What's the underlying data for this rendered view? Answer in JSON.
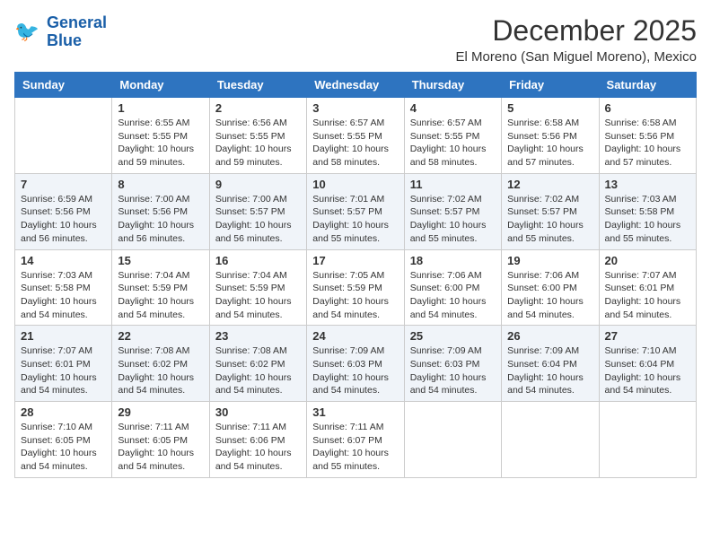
{
  "header": {
    "logo_line1": "General",
    "logo_line2": "Blue",
    "month": "December 2025",
    "location": "El Moreno (San Miguel Moreno), Mexico"
  },
  "weekdays": [
    "Sunday",
    "Monday",
    "Tuesday",
    "Wednesday",
    "Thursday",
    "Friday",
    "Saturday"
  ],
  "weeks": [
    [
      {
        "day": "",
        "sunrise": "",
        "sunset": "",
        "daylight": ""
      },
      {
        "day": "1",
        "sunrise": "Sunrise: 6:55 AM",
        "sunset": "Sunset: 5:55 PM",
        "daylight": "Daylight: 10 hours and 59 minutes."
      },
      {
        "day": "2",
        "sunrise": "Sunrise: 6:56 AM",
        "sunset": "Sunset: 5:55 PM",
        "daylight": "Daylight: 10 hours and 59 minutes."
      },
      {
        "day": "3",
        "sunrise": "Sunrise: 6:57 AM",
        "sunset": "Sunset: 5:55 PM",
        "daylight": "Daylight: 10 hours and 58 minutes."
      },
      {
        "day": "4",
        "sunrise": "Sunrise: 6:57 AM",
        "sunset": "Sunset: 5:55 PM",
        "daylight": "Daylight: 10 hours and 58 minutes."
      },
      {
        "day": "5",
        "sunrise": "Sunrise: 6:58 AM",
        "sunset": "Sunset: 5:56 PM",
        "daylight": "Daylight: 10 hours and 57 minutes."
      },
      {
        "day": "6",
        "sunrise": "Sunrise: 6:58 AM",
        "sunset": "Sunset: 5:56 PM",
        "daylight": "Daylight: 10 hours and 57 minutes."
      }
    ],
    [
      {
        "day": "7",
        "sunrise": "Sunrise: 6:59 AM",
        "sunset": "Sunset: 5:56 PM",
        "daylight": "Daylight: 10 hours and 56 minutes."
      },
      {
        "day": "8",
        "sunrise": "Sunrise: 7:00 AM",
        "sunset": "Sunset: 5:56 PM",
        "daylight": "Daylight: 10 hours and 56 minutes."
      },
      {
        "day": "9",
        "sunrise": "Sunrise: 7:00 AM",
        "sunset": "Sunset: 5:57 PM",
        "daylight": "Daylight: 10 hours and 56 minutes."
      },
      {
        "day": "10",
        "sunrise": "Sunrise: 7:01 AM",
        "sunset": "Sunset: 5:57 PM",
        "daylight": "Daylight: 10 hours and 55 minutes."
      },
      {
        "day": "11",
        "sunrise": "Sunrise: 7:02 AM",
        "sunset": "Sunset: 5:57 PM",
        "daylight": "Daylight: 10 hours and 55 minutes."
      },
      {
        "day": "12",
        "sunrise": "Sunrise: 7:02 AM",
        "sunset": "Sunset: 5:57 PM",
        "daylight": "Daylight: 10 hours and 55 minutes."
      },
      {
        "day": "13",
        "sunrise": "Sunrise: 7:03 AM",
        "sunset": "Sunset: 5:58 PM",
        "daylight": "Daylight: 10 hours and 55 minutes."
      }
    ],
    [
      {
        "day": "14",
        "sunrise": "Sunrise: 7:03 AM",
        "sunset": "Sunset: 5:58 PM",
        "daylight": "Daylight: 10 hours and 54 minutes."
      },
      {
        "day": "15",
        "sunrise": "Sunrise: 7:04 AM",
        "sunset": "Sunset: 5:59 PM",
        "daylight": "Daylight: 10 hours and 54 minutes."
      },
      {
        "day": "16",
        "sunrise": "Sunrise: 7:04 AM",
        "sunset": "Sunset: 5:59 PM",
        "daylight": "Daylight: 10 hours and 54 minutes."
      },
      {
        "day": "17",
        "sunrise": "Sunrise: 7:05 AM",
        "sunset": "Sunset: 5:59 PM",
        "daylight": "Daylight: 10 hours and 54 minutes."
      },
      {
        "day": "18",
        "sunrise": "Sunrise: 7:06 AM",
        "sunset": "Sunset: 6:00 PM",
        "daylight": "Daylight: 10 hours and 54 minutes."
      },
      {
        "day": "19",
        "sunrise": "Sunrise: 7:06 AM",
        "sunset": "Sunset: 6:00 PM",
        "daylight": "Daylight: 10 hours and 54 minutes."
      },
      {
        "day": "20",
        "sunrise": "Sunrise: 7:07 AM",
        "sunset": "Sunset: 6:01 PM",
        "daylight": "Daylight: 10 hours and 54 minutes."
      }
    ],
    [
      {
        "day": "21",
        "sunrise": "Sunrise: 7:07 AM",
        "sunset": "Sunset: 6:01 PM",
        "daylight": "Daylight: 10 hours and 54 minutes."
      },
      {
        "day": "22",
        "sunrise": "Sunrise: 7:08 AM",
        "sunset": "Sunset: 6:02 PM",
        "daylight": "Daylight: 10 hours and 54 minutes."
      },
      {
        "day": "23",
        "sunrise": "Sunrise: 7:08 AM",
        "sunset": "Sunset: 6:02 PM",
        "daylight": "Daylight: 10 hours and 54 minutes."
      },
      {
        "day": "24",
        "sunrise": "Sunrise: 7:09 AM",
        "sunset": "Sunset: 6:03 PM",
        "daylight": "Daylight: 10 hours and 54 minutes."
      },
      {
        "day": "25",
        "sunrise": "Sunrise: 7:09 AM",
        "sunset": "Sunset: 6:03 PM",
        "daylight": "Daylight: 10 hours and 54 minutes."
      },
      {
        "day": "26",
        "sunrise": "Sunrise: 7:09 AM",
        "sunset": "Sunset: 6:04 PM",
        "daylight": "Daylight: 10 hours and 54 minutes."
      },
      {
        "day": "27",
        "sunrise": "Sunrise: 7:10 AM",
        "sunset": "Sunset: 6:04 PM",
        "daylight": "Daylight: 10 hours and 54 minutes."
      }
    ],
    [
      {
        "day": "28",
        "sunrise": "Sunrise: 7:10 AM",
        "sunset": "Sunset: 6:05 PM",
        "daylight": "Daylight: 10 hours and 54 minutes."
      },
      {
        "day": "29",
        "sunrise": "Sunrise: 7:11 AM",
        "sunset": "Sunset: 6:05 PM",
        "daylight": "Daylight: 10 hours and 54 minutes."
      },
      {
        "day": "30",
        "sunrise": "Sunrise: 7:11 AM",
        "sunset": "Sunset: 6:06 PM",
        "daylight": "Daylight: 10 hours and 54 minutes."
      },
      {
        "day": "31",
        "sunrise": "Sunrise: 7:11 AM",
        "sunset": "Sunset: 6:07 PM",
        "daylight": "Daylight: 10 hours and 55 minutes."
      },
      {
        "day": "",
        "sunrise": "",
        "sunset": "",
        "daylight": ""
      },
      {
        "day": "",
        "sunrise": "",
        "sunset": "",
        "daylight": ""
      },
      {
        "day": "",
        "sunrise": "",
        "sunset": "",
        "daylight": ""
      }
    ]
  ]
}
